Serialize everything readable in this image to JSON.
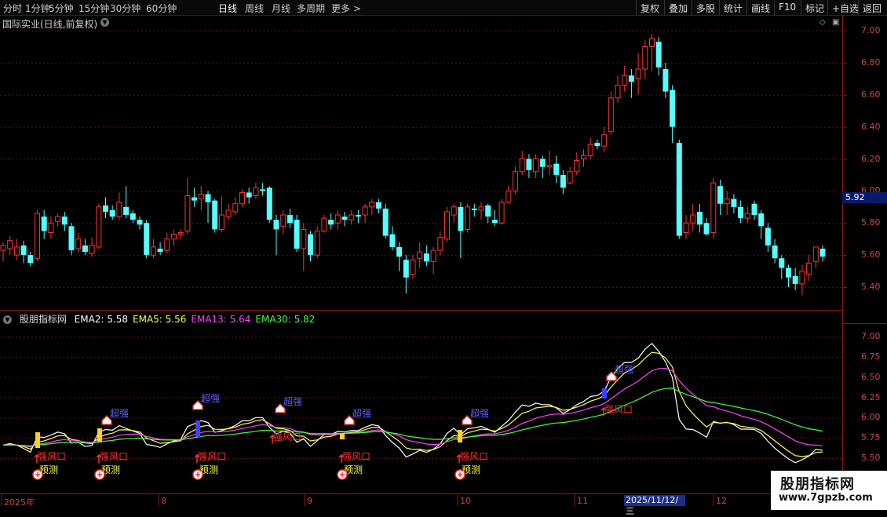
{
  "toolbar": {
    "periods": [
      "分时",
      "1分钟",
      "5分钟",
      "15分钟",
      "30分钟",
      "60分钟",
      "日线",
      "周线",
      "月线",
      "多周期",
      "更多 >"
    ],
    "active_index": 6,
    "right_buttons": [
      "复权",
      "叠加",
      "多股",
      "统计",
      "画线",
      "F10",
      "标记",
      "+自选",
      "返回"
    ]
  },
  "main": {
    "title": "国际实业(日线,前复权)",
    "price_axis": [
      "7.00",
      "6.80",
      "6.60",
      "6.40",
      "6.20",
      "6.00",
      "5.80",
      "5.60",
      "5.40"
    ],
    "current_price": "5.92"
  },
  "indicator": {
    "name": "股朋指标网",
    "items": [
      {
        "label": "EMA2: 5.58",
        "color": "#ffffff"
      },
      {
        "label": "EMA5: 5.56",
        "color": "#ffff40"
      },
      {
        "label": "EMA13: 5.64",
        "color": "#ff40ff"
      },
      {
        "label": "EMA30: 5.82",
        "color": "#40ff40"
      }
    ],
    "axis": [
      "7.00",
      "6.75",
      "6.50",
      "6.25",
      "6.00",
      "5.75",
      "5.50"
    ],
    "signal_texts": {
      "strong": "强风口",
      "pred": "预测",
      "super": "超强"
    }
  },
  "dates": [
    "2025年",
    "8",
    "9",
    "10",
    "11",
    "2025/11/12/三",
    "12"
  ],
  "watermark": {
    "line1": "股朋指标网",
    "line2": "www.7gpzb.com"
  },
  "colors": {
    "up": "#ff3333",
    "down": "#54ffff",
    "grid": "#5a1010",
    "axis": "#8a1818"
  },
  "chart_data": {
    "type": "candlestick",
    "ylim": [
      5.3,
      7.05
    ],
    "candles": [
      [
        5.63,
        5.66,
        5.56,
        5.68
      ],
      [
        5.64,
        5.69,
        5.6,
        5.72
      ],
      [
        5.6,
        5.65,
        5.57,
        5.7
      ],
      [
        5.66,
        5.6,
        5.55,
        5.69
      ],
      [
        5.6,
        5.55,
        5.53,
        5.62
      ],
      [
        5.58,
        5.86,
        5.56,
        5.88
      ],
      [
        5.84,
        5.75,
        5.7,
        5.88
      ],
      [
        5.74,
        5.8,
        5.7,
        5.84
      ],
      [
        5.81,
        5.84,
        5.78,
        5.86
      ],
      [
        5.84,
        5.79,
        5.75,
        5.87
      ],
      [
        5.78,
        5.63,
        5.6,
        5.8
      ],
      [
        5.64,
        5.7,
        5.62,
        5.74
      ],
      [
        5.66,
        5.62,
        5.6,
        5.7
      ],
      [
        5.61,
        5.66,
        5.59,
        5.71
      ],
      [
        5.65,
        5.9,
        5.64,
        5.92
      ],
      [
        5.91,
        5.87,
        5.83,
        5.96
      ],
      [
        5.88,
        5.84,
        5.82,
        5.91
      ],
      [
        5.84,
        5.93,
        5.82,
        5.99
      ],
      [
        5.9,
        5.85,
        5.83,
        6.03
      ],
      [
        5.86,
        5.82,
        5.8,
        5.88
      ],
      [
        5.82,
        5.79,
        5.76,
        5.84
      ],
      [
        5.8,
        5.6,
        5.58,
        5.82
      ],
      [
        5.6,
        5.65,
        5.58,
        5.7
      ],
      [
        5.64,
        5.62,
        5.6,
        5.68
      ],
      [
        5.63,
        5.7,
        5.61,
        5.74
      ],
      [
        5.7,
        5.73,
        5.66,
        5.76
      ],
      [
        5.73,
        5.74,
        5.7,
        5.76
      ],
      [
        5.75,
        5.97,
        5.73,
        6.08
      ],
      [
        5.96,
        5.94,
        5.9,
        6.02
      ],
      [
        5.95,
        5.98,
        5.88,
        6.03
      ],
      [
        5.98,
        5.93,
        5.8,
        6.0
      ],
      [
        5.94,
        5.76,
        5.74,
        5.95
      ],
      [
        5.76,
        5.85,
        5.74,
        5.97
      ],
      [
        5.84,
        5.88,
        5.82,
        5.92
      ],
      [
        5.87,
        5.92,
        5.85,
        5.96
      ],
      [
        5.92,
        5.99,
        5.9,
        6.01
      ],
      [
        5.99,
        5.96,
        5.92,
        6.02
      ],
      [
        5.97,
        6.02,
        5.95,
        6.05
      ],
      [
        6.01,
        6.0,
        5.97,
        6.05
      ],
      [
        6.02,
        5.82,
        5.8,
        6.03
      ],
      [
        5.82,
        5.76,
        5.6,
        5.85
      ],
      [
        5.78,
        5.85,
        5.73,
        5.88
      ],
      [
        5.85,
        5.8,
        5.77,
        5.89
      ],
      [
        5.82,
        5.64,
        5.62,
        5.85
      ],
      [
        5.64,
        5.76,
        5.5,
        5.8
      ],
      [
        5.73,
        5.6,
        5.56,
        5.75
      ],
      [
        5.6,
        5.75,
        5.58,
        5.78
      ],
      [
        5.75,
        5.83,
        5.74,
        5.85
      ],
      [
        5.82,
        5.79,
        5.76,
        5.86
      ],
      [
        5.8,
        5.85,
        5.76,
        5.88
      ],
      [
        5.84,
        5.82,
        5.78,
        5.87
      ],
      [
        5.82,
        5.85,
        5.79,
        5.88
      ],
      [
        5.85,
        5.84,
        5.8,
        5.88
      ],
      [
        5.85,
        5.9,
        5.8,
        5.92
      ],
      [
        5.9,
        5.93,
        5.85,
        5.95
      ],
      [
        5.93,
        5.89,
        5.86,
        5.95
      ],
      [
        5.89,
        5.72,
        5.7,
        5.92
      ],
      [
        5.73,
        5.65,
        5.63,
        5.78
      ],
      [
        5.65,
        5.59,
        5.5,
        5.68
      ],
      [
        5.57,
        5.46,
        5.36,
        5.6
      ],
      [
        5.48,
        5.57,
        5.45,
        5.6
      ],
      [
        5.58,
        5.62,
        5.52,
        5.68
      ],
      [
        5.61,
        5.56,
        5.53,
        5.66
      ],
      [
        5.56,
        5.63,
        5.48,
        5.65
      ],
      [
        5.63,
        5.71,
        5.6,
        5.75
      ],
      [
        5.7,
        5.87,
        5.68,
        5.9
      ],
      [
        5.85,
        5.9,
        5.8,
        5.92
      ],
      [
        5.9,
        5.75,
        5.58,
        5.93
      ],
      [
        5.76,
        5.9,
        5.74,
        5.92
      ],
      [
        5.89,
        5.88,
        5.84,
        5.92
      ],
      [
        5.88,
        5.9,
        5.82,
        5.93
      ],
      [
        5.91,
        5.84,
        5.8,
        5.92
      ],
      [
        5.82,
        5.8,
        5.78,
        5.88
      ],
      [
        5.8,
        5.93,
        5.79,
        5.95
      ],
      [
        5.93,
        6.0,
        5.92,
        6.03
      ],
      [
        6.0,
        6.12,
        5.98,
        6.15
      ],
      [
        6.12,
        6.2,
        6.1,
        6.25
      ],
      [
        6.2,
        6.13,
        6.08,
        6.23
      ],
      [
        6.12,
        6.2,
        6.08,
        6.23
      ],
      [
        6.2,
        6.15,
        6.08,
        6.22
      ],
      [
        6.15,
        6.16,
        6.1,
        6.25
      ],
      [
        6.17,
        6.1,
        6.05,
        6.22
      ],
      [
        6.1,
        6.02,
        5.98,
        6.13
      ],
      [
        6.05,
        6.12,
        6.04,
        6.15
      ],
      [
        6.12,
        6.19,
        6.1,
        6.24
      ],
      [
        6.2,
        6.22,
        6.15,
        6.26
      ],
      [
        6.22,
        6.29,
        6.2,
        6.33
      ],
      [
        6.3,
        6.28,
        6.26,
        6.32
      ],
      [
        6.28,
        6.35,
        6.24,
        6.4
      ],
      [
        6.37,
        6.58,
        6.35,
        6.62
      ],
      [
        6.58,
        6.66,
        6.55,
        6.72
      ],
      [
        6.66,
        6.72,
        6.62,
        6.78
      ],
      [
        6.72,
        6.68,
        6.58,
        6.76
      ],
      [
        6.7,
        6.76,
        6.6,
        6.86
      ],
      [
        6.76,
        6.9,
        6.7,
        6.94
      ],
      [
        6.9,
        6.95,
        6.75,
        6.98
      ],
      [
        6.93,
        6.77,
        6.72,
        6.96
      ],
      [
        6.76,
        6.62,
        6.58,
        6.8
      ],
      [
        6.63,
        6.4,
        6.3,
        6.66
      ],
      [
        6.3,
        5.72,
        5.7,
        6.32
      ],
      [
        5.74,
        5.8,
        5.7,
        5.85
      ],
      [
        5.8,
        5.85,
        5.75,
        5.92
      ],
      [
        5.87,
        5.79,
        5.74,
        5.92
      ],
      [
        5.8,
        5.73,
        5.72,
        5.83
      ],
      [
        5.74,
        6.05,
        5.7,
        6.08
      ],
      [
        6.03,
        5.92,
        5.85,
        6.07
      ],
      [
        5.92,
        5.95,
        5.85,
        6.0
      ],
      [
        5.95,
        5.9,
        5.86,
        5.98
      ],
      [
        5.9,
        5.83,
        5.8,
        5.94
      ],
      [
        5.83,
        5.86,
        5.8,
        5.9
      ],
      [
        5.92,
        5.85,
        5.82,
        5.94
      ],
      [
        5.86,
        5.78,
        5.7,
        5.88
      ],
      [
        5.77,
        5.66,
        5.62,
        5.8
      ],
      [
        5.66,
        5.58,
        5.55,
        5.7
      ],
      [
        5.58,
        5.52,
        5.45,
        5.6
      ],
      [
        5.52,
        5.46,
        5.4,
        5.54
      ],
      [
        5.47,
        5.42,
        5.38,
        5.52
      ],
      [
        5.42,
        5.5,
        5.35,
        5.54
      ],
      [
        5.48,
        5.55,
        5.44,
        5.6
      ],
      [
        5.56,
        5.65,
        5.52,
        5.65
      ],
      [
        5.64,
        5.59,
        5.56,
        5.66
      ]
    ]
  }
}
